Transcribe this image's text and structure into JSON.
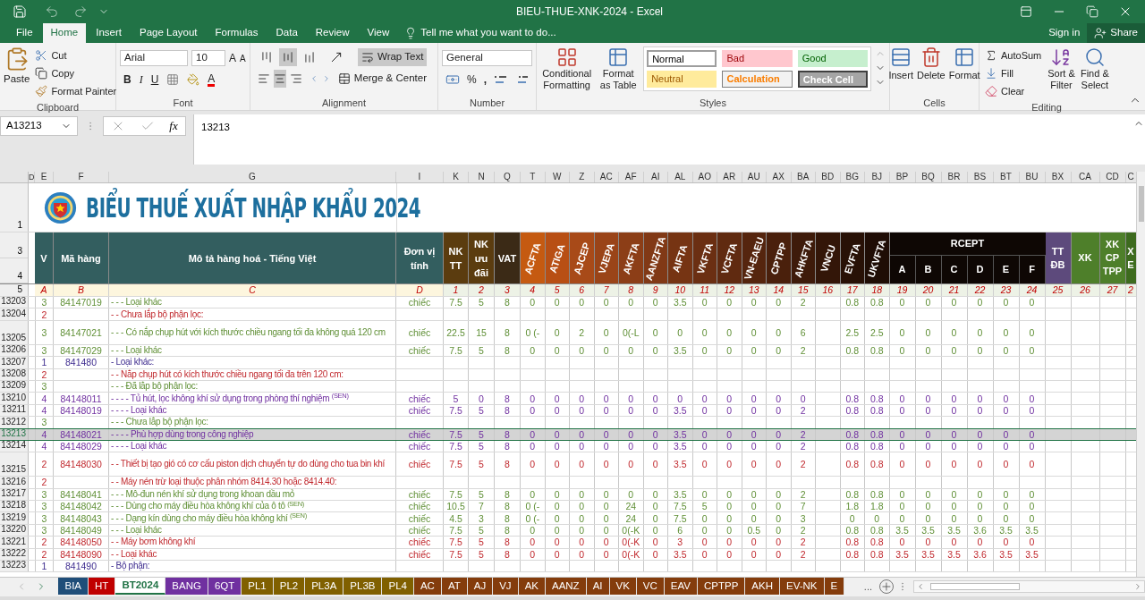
{
  "window": {
    "title": "BIEU-THUE-XNK-2024 - Excel"
  },
  "ribbon_tabs": [
    {
      "label": "File",
      "selected": false
    },
    {
      "label": "Home",
      "selected": true
    },
    {
      "label": "Insert",
      "selected": false
    },
    {
      "label": "Page Layout",
      "selected": false
    },
    {
      "label": "Formulas",
      "selected": false
    },
    {
      "label": "Data",
      "selected": false
    },
    {
      "label": "Review",
      "selected": false
    },
    {
      "label": "View",
      "selected": false
    }
  ],
  "tell_me": "Tell me what you want to do...",
  "sign_in": "Sign in",
  "share": "Share",
  "ribbon": {
    "clipboard": {
      "paste": "Paste",
      "cut": "Cut",
      "copy": "Copy",
      "format_painter": "Format Painter",
      "label": "Clipboard"
    },
    "font": {
      "name": "Arial",
      "size": "10",
      "grow": "A",
      "shrink": "A",
      "bold": "B",
      "italic": "I",
      "underline": "U",
      "font_color": "A",
      "label": "Font"
    },
    "alignment": {
      "vertical": [
        {
          "kind": "top",
          "selected": false
        },
        {
          "kind": "middle",
          "selected": true
        },
        {
          "kind": "bottom",
          "selected": false
        }
      ],
      "horizontal": [
        {
          "kind": "left",
          "selected": false
        },
        {
          "kind": "center",
          "selected": true
        },
        {
          "kind": "right",
          "selected": false
        }
      ],
      "wrap_text": {
        "label": "Wrap Text",
        "on": true
      },
      "merge": "Merge & Center",
      "label": "Alignment"
    },
    "number": {
      "format": "General",
      "percent": "%",
      "comma": ",",
      "label": "Number"
    },
    "styles": {
      "conditional": "Conditional Formatting",
      "format_table": "Format as Table",
      "cells": [
        {
          "text": "Normal",
          "kind": "normal"
        },
        {
          "text": "Bad",
          "kind": "bad"
        },
        {
          "text": "Good",
          "kind": "good"
        },
        {
          "text": "Neutral",
          "kind": "neutral"
        },
        {
          "text": "Calculation",
          "kind": "calculation"
        },
        {
          "text": "Check Cell",
          "kind": "check"
        }
      ],
      "label": "Styles"
    },
    "cells": {
      "insert": "Insert",
      "delete": "Delete",
      "format": "Format",
      "label": "Cells"
    },
    "editing": {
      "autosum": "AutoSum",
      "fill": "Fill",
      "clear": "Clear",
      "sort": "Sort & Filter",
      "find": "Find & Select",
      "label": "Editing"
    }
  },
  "formula_bar": {
    "name_box": "A13213",
    "fx": "fx",
    "formula": "13213"
  },
  "sheet": {
    "column_letters": [
      "D",
      "E",
      "F",
      "G",
      "I",
      "K",
      "N",
      "Q",
      "T",
      "W",
      "Z",
      "AC",
      "AF",
      "AI",
      "AL",
      "AO",
      "AR",
      "AU",
      "AX",
      "BA",
      "BD",
      "BG",
      "BJ",
      "BP",
      "BQ",
      "BR",
      "BS",
      "BT",
      "BU",
      "BX",
      "CA",
      "CD",
      "C"
    ],
    "title_row": "1",
    "header_row_numbers": [
      "3",
      "4"
    ],
    "index_row_number": "5",
    "title": "BIỂU THUẾ XUẤT NHẬP KHẨU 2024",
    "headers": [
      {
        "text": "V",
        "color": "#335e5f",
        "kind": "plain"
      },
      {
        "text": "Mã hàng",
        "color": "#335e5f",
        "kind": "plain"
      },
      {
        "text": "Mô tả hàng hoá - Tiếng Việt",
        "color": "#335e5f",
        "kind": "plain"
      },
      {
        "text": "Đơn vị tính",
        "color": "#335e5f",
        "kind": "plain"
      },
      {
        "text": "NK TT",
        "color": "#5b3c0f",
        "kind": "plain"
      },
      {
        "text": "NK ưu đãi",
        "color": "#5b3c0f",
        "kind": "plain"
      },
      {
        "text": "VAT",
        "color": "#3b2a16",
        "kind": "plain"
      },
      {
        "text": "ACFTA",
        "color": "#c55a11",
        "kind": "rotated"
      },
      {
        "text": "ATIGA",
        "color": "#b84f14",
        "kind": "rotated"
      },
      {
        "text": "AJCEP",
        "color": "#a84a18",
        "kind": "rotated"
      },
      {
        "text": "VJEPA",
        "color": "#9a4418",
        "kind": "rotated"
      },
      {
        "text": "AKFTA",
        "color": "#8c3e17",
        "kind": "rotated"
      },
      {
        "text": "AANZFTA",
        "color": "#813916",
        "kind": "rotated"
      },
      {
        "text": "AIFTA",
        "color": "#763413",
        "kind": "rotated"
      },
      {
        "text": "VKFTA",
        "color": "#6b2f12",
        "kind": "rotated"
      },
      {
        "text": "VCFTA",
        "color": "#602a10",
        "kind": "rotated"
      },
      {
        "text": "VN-EAEU",
        "color": "#55250e",
        "kind": "rotated"
      },
      {
        "text": "CPTPP",
        "color": "#4a200c",
        "kind": "rotated"
      },
      {
        "text": "AHKFTA",
        "color": "#3e1b0a",
        "kind": "rotated"
      },
      {
        "text": "VNCU",
        "color": "#331608",
        "kind": "rotated"
      },
      {
        "text": "EVFTA",
        "color": "#281106",
        "kind": "rotated"
      },
      {
        "text": "UKVFTA",
        "color": "#1f0d05",
        "kind": "rotated"
      }
    ],
    "rcept": {
      "text": "RCEPT",
      "color": "#0e0704",
      "subs": [
        "A",
        "B",
        "C",
        "D",
        "E",
        "F"
      ]
    },
    "trailing_headers": [
      {
        "text": "TT ĐB",
        "color": "#5d4a7c"
      },
      {
        "text": "XK",
        "color": "#4e7f2a"
      },
      {
        "text": "XK CP TPP",
        "color": "#4e7f2a"
      },
      {
        "text": "X E",
        "color": "#3d6b1e"
      }
    ],
    "index": [
      "A",
      "B",
      "C",
      "D",
      "1",
      "2",
      "3",
      "4",
      "5",
      "6",
      "7",
      "8",
      "9",
      "10",
      "11",
      "12",
      "13",
      "14",
      "15",
      "16",
      "17",
      "18",
      "19",
      "20",
      "21",
      "22",
      "23",
      "24",
      "25",
      "26",
      "27",
      "2"
    ],
    "rows": [
      {
        "row": "13203",
        "v": "3",
        "code": "84147019",
        "desc": "- - - Loại khác",
        "unit": "chiếc",
        "kind": "subheading",
        "selected": false,
        "tall": false,
        "rates": [
          "7.5",
          "5",
          "8",
          "0",
          "0",
          "0",
          "0",
          "0",
          "0",
          "3.5",
          "0",
          "0",
          "0",
          "0",
          "2"
        ],
        "rates_2": [
          "0.8",
          "0.8",
          "0",
          "0",
          "0",
          "0",
          "0",
          "0"
        ]
      },
      {
        "row": "13204",
        "v": "2",
        "desc": "- - Chưa lắp bộ phận lọc:",
        "kind": "heading",
        "selected": false,
        "tall": false
      },
      {
        "row": "13205",
        "v": "3",
        "code": "84147021",
        "desc": "- - - Có nắp chụp hút với kích thước chiều ngang tối đa không quá 120 cm",
        "unit": "chiếc",
        "kind": "subheading",
        "selected": false,
        "tall": true,
        "rates": [
          "22.5",
          "15",
          "8",
          "0 (-",
          "0",
          "2",
          "0",
          "0(-L",
          "0",
          "0",
          "0",
          "0",
          "0",
          "0",
          "6"
        ],
        "rates_2": [
          "2.5",
          "2.5",
          "0",
          "0",
          "0",
          "0",
          "0",
          "0"
        ]
      },
      {
        "row": "13206",
        "v": "3",
        "code": "84147029",
        "desc": "- - - Loại khác",
        "unit": "chiếc",
        "kind": "subheading",
        "selected": false,
        "tall": false,
        "rates": [
          "7.5",
          "5",
          "8",
          "0",
          "0",
          "0",
          "0",
          "0",
          "0",
          "3.5",
          "0",
          "0",
          "0",
          "0",
          "2"
        ],
        "rates_2": [
          "0.8",
          "0.8",
          "0",
          "0",
          "0",
          "0",
          "0",
          "0"
        ]
      },
      {
        "row": "13207",
        "v": "1",
        "code": "841480",
        "desc": "- Loại khác:",
        "kind": "chapter",
        "selected": false,
        "tall": false
      },
      {
        "row": "13208",
        "v": "2",
        "desc": "- - Nắp chụp hút có kích thước chiều ngang tối đa trên 120 cm:",
        "kind": "heading",
        "selected": false,
        "tall": false
      },
      {
        "row": "13209",
        "v": "3",
        "desc": "- - - Đã lắp bộ phận lọc:",
        "kind": "subheading",
        "selected": false,
        "tall": false
      },
      {
        "row": "13210",
        "v": "4",
        "code": "84148011",
        "desc": "- - - - Tủ hút, lọc không khí sử dụng trong phòng thí nghiệm $^{(SEN)}$",
        "unit": "chiếc",
        "kind": "item",
        "selected": false,
        "tall": false,
        "rates": [
          "5",
          "0",
          "8",
          "0",
          "0",
          "0",
          "0",
          "0",
          "0",
          "0",
          "0",
          "0",
          "0",
          "0",
          "0"
        ],
        "rates_2": [
          "0.8",
          "0.8",
          "0",
          "0",
          "0",
          "0",
          "0",
          "0"
        ]
      },
      {
        "row": "13211",
        "v": "4",
        "code": "84148019",
        "desc": "- - - - Loại khác",
        "unit": "chiếc",
        "kind": "item",
        "selected": false,
        "tall": false,
        "rates": [
          "7.5",
          "5",
          "8",
          "0",
          "0",
          "0",
          "0",
          "0",
          "0",
          "3.5",
          "0",
          "0",
          "0",
          "0",
          "2"
        ],
        "rates_2": [
          "0.8",
          "0.8",
          "0",
          "0",
          "0",
          "0",
          "0",
          "0"
        ]
      },
      {
        "row": "13212",
        "v": "3",
        "desc": "- - - Chưa lắp bộ phận lọc:",
        "kind": "subheading",
        "selected": false,
        "tall": false
      },
      {
        "row": "13213",
        "v": "4",
        "code": "84148021",
        "desc": "- - - - Phù hợp dùng trong công nghiệp",
        "unit": "chiếc",
        "kind": "item",
        "selected": true,
        "tall": false,
        "rates": [
          "7.5",
          "5",
          "8",
          "0",
          "0",
          "0",
          "0",
          "0",
          "0",
          "3.5",
          "0",
          "0",
          "0",
          "0",
          "2"
        ],
        "rates_2": [
          "0.8",
          "0.8",
          "0",
          "0",
          "0",
          "0",
          "0",
          "0"
        ]
      },
      {
        "row": "13214",
        "v": "4",
        "code": "84148029",
        "desc": "- - - - Loại khác",
        "unit": "chiếc",
        "kind": "item",
        "selected": false,
        "tall": false,
        "rates": [
          "7.5",
          "5",
          "8",
          "0",
          "0",
          "0",
          "0",
          "0",
          "0",
          "3.5",
          "0",
          "0",
          "0",
          "0",
          "2"
        ],
        "rates_2": [
          "0.8",
          "0.8",
          "0",
          "0",
          "0",
          "0",
          "0",
          "0"
        ]
      },
      {
        "row": "13215",
        "v": "2",
        "code": "84148030",
        "desc": "- - Thiết bị tạo gió có cơ cấu piston dịch chuyển tự do dùng cho tua bin khí",
        "unit": "chiếc",
        "kind": "heading",
        "selected": false,
        "tall": true,
        "rates": [
          "7.5",
          "5",
          "8",
          "0",
          "0",
          "0",
          "0",
          "0",
          "0",
          "3.5",
          "0",
          "0",
          "0",
          "0",
          "2"
        ],
        "rates_2": [
          "0.8",
          "0.8",
          "0",
          "0",
          "0",
          "0",
          "0",
          "0"
        ]
      },
      {
        "row": "13216",
        "v": "2",
        "desc": "- - Máy nén trừ loại thuộc phân nhóm 8414.30 hoặc 8414.40:",
        "kind": "heading",
        "selected": false,
        "tall": false
      },
      {
        "row": "13217",
        "v": "3",
        "code": "84148041",
        "desc": "- - - Mô-đun nén khí sử dụng trong khoan dầu mỏ",
        "unit": "chiếc",
        "kind": "subheading",
        "selected": false,
        "tall": false,
        "rates": [
          "7.5",
          "5",
          "8",
          "0",
          "0",
          "0",
          "0",
          "0",
          "0",
          "3.5",
          "0",
          "0",
          "0",
          "0",
          "2"
        ],
        "rates_2": [
          "0.8",
          "0.8",
          "0",
          "0",
          "0",
          "0",
          "0",
          "0"
        ]
      },
      {
        "row": "13218",
        "v": "3",
        "code": "84148042",
        "desc": "- - - Dùng cho máy điều hòa không khí của ô tô $^{(SEN)}$",
        "unit": "chiếc",
        "kind": "subheading",
        "selected": false,
        "tall": false,
        "rates": [
          "10.5",
          "7",
          "8",
          "0 (-",
          "0",
          "0",
          "0",
          "24",
          "0",
          "7.5",
          "5",
          "0",
          "0",
          "0",
          "7"
        ],
        "rates_2": [
          "1.8",
          "1.8",
          "0",
          "0",
          "0",
          "0",
          "0",
          "0"
        ]
      },
      {
        "row": "13219",
        "v": "3",
        "code": "84148043",
        "desc": "- - - Dạng kín dùng cho máy điều hòa không khí $^{(SEN)}$",
        "unit": "chiếc",
        "kind": "subheading",
        "selected": false,
        "tall": false,
        "rates": [
          "4.5",
          "3",
          "8",
          "0 (-",
          "0",
          "0",
          "0",
          "24",
          "0",
          "7.5",
          "0",
          "0",
          "0",
          "0",
          "3"
        ],
        "rates_2": [
          "0",
          "0",
          "0",
          "0",
          "0",
          "0",
          "0",
          "0"
        ]
      },
      {
        "row": "13220",
        "v": "3",
        "code": "84148049",
        "desc": "- - - Loại khác",
        "unit": "chiếc",
        "kind": "subheading",
        "selected": false,
        "tall": false,
        "rates": [
          "7.5",
          "5",
          "8",
          "0",
          "0",
          "0",
          "0",
          "0(-K",
          "0",
          "6",
          "0",
          "0",
          "0.5",
          "0",
          "2"
        ],
        "rates_2": [
          "0.8",
          "0.8",
          "3.5",
          "3.5",
          "3.5",
          "3.6",
          "3.5",
          "3.5"
        ]
      },
      {
        "row": "13221",
        "v": "2",
        "code": "84148050",
        "desc": "- - Máy bơm không khí",
        "unit": "chiếc",
        "kind": "heading",
        "selected": false,
        "tall": false,
        "rates": [
          "7.5",
          "5",
          "8",
          "0",
          "0",
          "0",
          "0",
          "0(-K",
          "0",
          "3",
          "0",
          "0",
          "0",
          "0",
          "2"
        ],
        "rates_2": [
          "0.8",
          "0.8",
          "0",
          "0",
          "0",
          "0",
          "0",
          "0"
        ]
      },
      {
        "row": "13222",
        "v": "2",
        "code": "84148090",
        "desc": "- - Loại khác",
        "unit": "chiếc",
        "kind": "heading",
        "selected": false,
        "tall": false,
        "rates": [
          "7.5",
          "5",
          "8",
          "0",
          "0",
          "0",
          "0",
          "0(-K",
          "0",
          "3.5",
          "0",
          "0",
          "0",
          "0",
          "2"
        ],
        "rates_2": [
          "0.8",
          "0.8",
          "3.5",
          "3.5",
          "3.5",
          "3.6",
          "3.5",
          "3.5"
        ]
      },
      {
        "row": "13223",
        "v": "1",
        "code": "841490",
        "desc": "- Bộ phận:",
        "kind": "chapter",
        "selected": false,
        "tall": false
      }
    ]
  },
  "sheet_tabs": [
    {
      "label": "BIA",
      "color": "#1f4e79",
      "selected": false
    },
    {
      "label": "HT",
      "color": "#c00000",
      "selected": false
    },
    {
      "label": "BT2024",
      "color": "#217346",
      "selected": true
    },
    {
      "label": "BANG",
      "color": "#7030a0",
      "selected": false
    },
    {
      "label": "6QT",
      "color": "#7030a0",
      "selected": false
    },
    {
      "label": "PL1",
      "color": "#806000",
      "selected": false
    },
    {
      "label": "PL2",
      "color": "#806000",
      "selected": false
    },
    {
      "label": "PL3A",
      "color": "#806000",
      "selected": false
    },
    {
      "label": "PL3B",
      "color": "#806000",
      "selected": false
    },
    {
      "label": "PL4",
      "color": "#806000",
      "selected": false
    },
    {
      "label": "AC",
      "color": "#843c0c",
      "selected": false
    },
    {
      "label": "AT",
      "color": "#843c0c",
      "selected": false
    },
    {
      "label": "AJ",
      "color": "#843c0c",
      "selected": false
    },
    {
      "label": "VJ",
      "color": "#843c0c",
      "selected": false
    },
    {
      "label": "AK",
      "color": "#843c0c",
      "selected": false
    },
    {
      "label": "AANZ",
      "color": "#843c0c",
      "selected": false
    },
    {
      "label": "AI",
      "color": "#843c0c",
      "selected": false
    },
    {
      "label": "VK",
      "color": "#843c0c",
      "selected": false
    },
    {
      "label": "VC",
      "color": "#843c0c",
      "selected": false
    },
    {
      "label": "EAV",
      "color": "#843c0c",
      "selected": false
    },
    {
      "label": "CPTPP",
      "color": "#843c0c",
      "selected": false
    },
    {
      "label": "AKH",
      "color": "#843c0c",
      "selected": false
    },
    {
      "label": "EV-NK",
      "color": "#843c0c",
      "selected": false
    },
    {
      "label": "E",
      "color": "#843c0c",
      "selected": false
    }
  ],
  "tabs_overflow": "..."
}
